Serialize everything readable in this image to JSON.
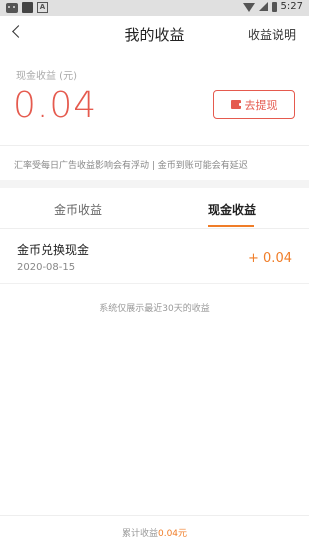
{
  "status_bar": {
    "time": "5:27",
    "left_icons": [
      "cat-icon",
      "square-icon",
      "image-a-icon"
    ],
    "right_icons": [
      "wifi-icon",
      "signal-icon",
      "battery-icon"
    ]
  },
  "nav": {
    "title": "我的收益",
    "right_link": "收益说明"
  },
  "cash": {
    "label": "现金收益 (元)",
    "amount": "0.04",
    "withdraw_label": "去提现",
    "accent_color": "#e55a4e"
  },
  "notice": "汇率受每日广告收益影响会有浮动 | 金币到账可能会有延迟",
  "tabs": [
    {
      "label": "金币收益",
      "active": false
    },
    {
      "label": "现金收益",
      "active": true
    }
  ],
  "records": [
    {
      "title": "金币兑换现金",
      "date": "2020-08-15",
      "value": "+ 0.04"
    }
  ],
  "footnote": "系统仅展示最近30天的收益",
  "bottom": {
    "label": "累计收益",
    "value": "0.04元",
    "accent_color": "#f07d28"
  }
}
